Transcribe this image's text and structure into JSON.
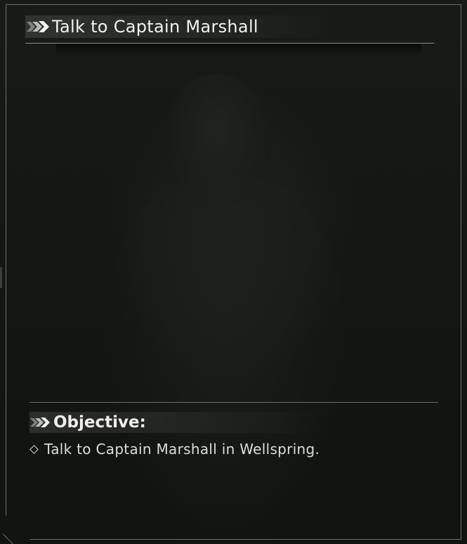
{
  "quest": {
    "title": "Talk to Captain Marshall",
    "title_icon": "double-chevron-right-icon"
  },
  "objective": {
    "heading": "Objective:",
    "heading_icon": "double-chevron-right-icon",
    "items": [
      {
        "bullet_icon": "diamond-bullet-icon",
        "text": "Talk to Captain Marshall in Wellspring."
      }
    ]
  },
  "colors": {
    "background": "#141613",
    "frame": "#6c6f6b",
    "text": "#f2f2f0"
  }
}
